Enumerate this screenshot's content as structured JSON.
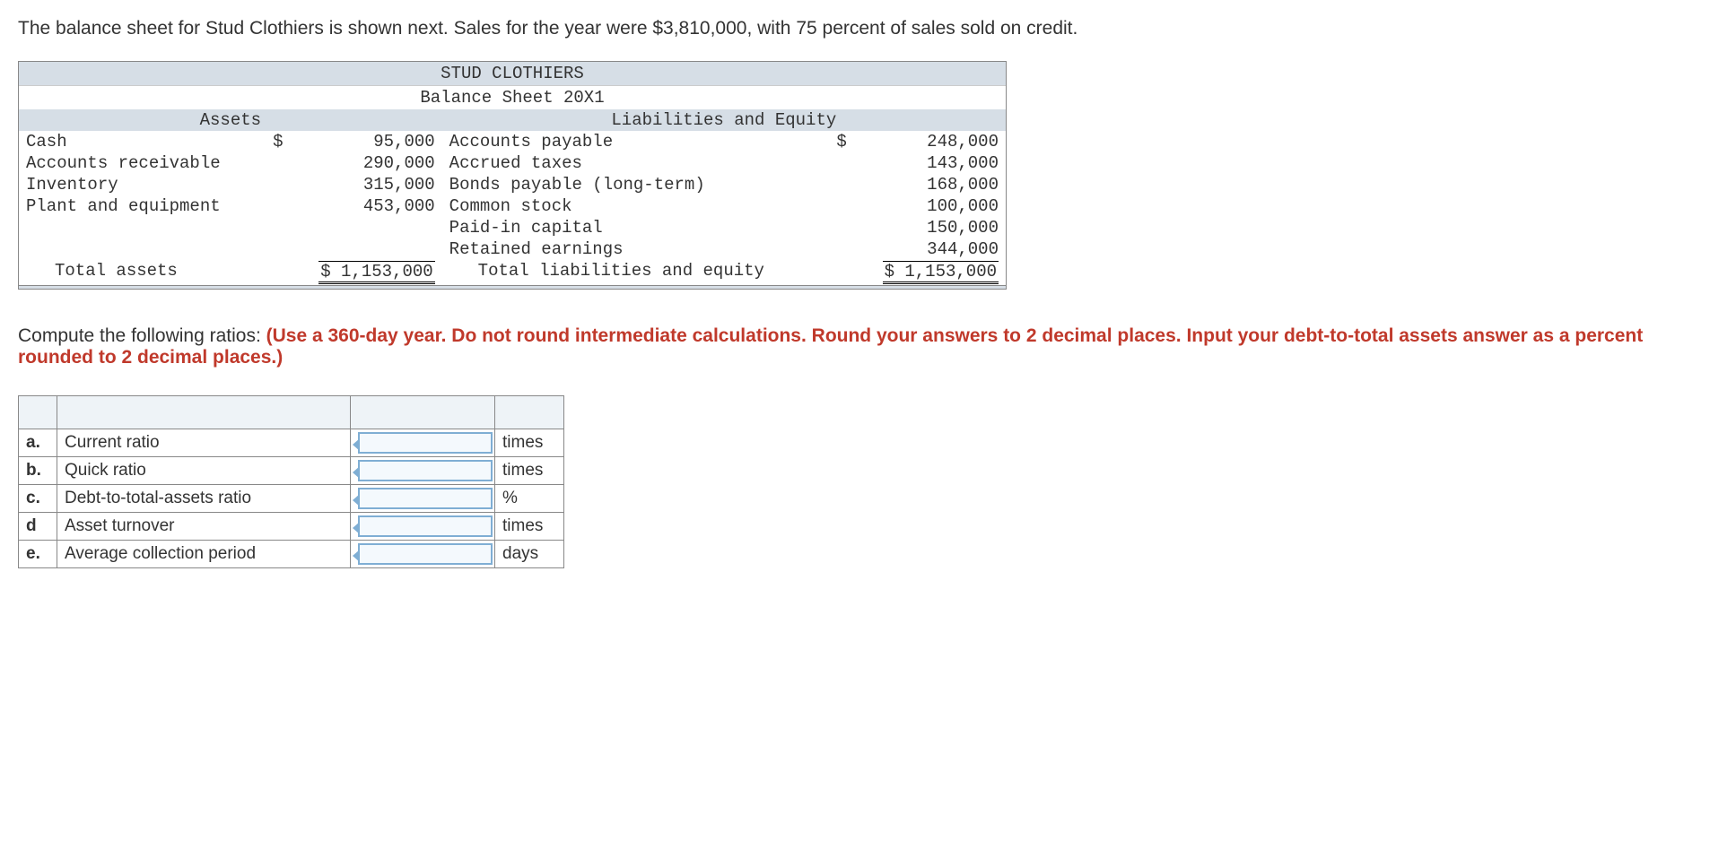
{
  "intro": "The balance sheet for Stud Clothiers is shown next. Sales for the year were $3,810,000, with 75 percent of sales sold on credit.",
  "bs": {
    "title": "STUD CLOTHIERS",
    "subtitle": "Balance Sheet 20X1",
    "assets_header": "Assets",
    "liab_header": "Liabilities and Equity",
    "assets": [
      {
        "label": "Cash",
        "cur": "$",
        "val": "95,000"
      },
      {
        "label": "Accounts receivable",
        "cur": "",
        "val": "290,000"
      },
      {
        "label": "Inventory",
        "cur": "",
        "val": "315,000"
      },
      {
        "label": "Plant and equipment",
        "cur": "",
        "val": "453,000"
      }
    ],
    "liabs": [
      {
        "label": "Accounts payable",
        "cur": "$",
        "val": "248,000"
      },
      {
        "label": "Accrued taxes",
        "cur": "",
        "val": "143,000"
      },
      {
        "label": "Bonds payable (long-term)",
        "cur": "",
        "val": "168,000"
      },
      {
        "label": "Common stock",
        "cur": "",
        "val": "100,000"
      },
      {
        "label": "Paid-in capital",
        "cur": "",
        "val": "150,000"
      },
      {
        "label": "Retained earnings",
        "cur": "",
        "val": "344,000"
      }
    ],
    "total_assets_label": "Total assets",
    "total_assets_val": "$ 1,153,000",
    "total_liab_label": "Total liabilities and equity",
    "total_liab_val": "$ 1,153,000"
  },
  "instr_lead": "Compute the following ratios: ",
  "instr_red": "(Use a 360-day year. Do not round intermediate calculations. Round your answers to 2 decimal places. Input your debt-to-total assets answer as a percent rounded to 2 decimal places.)",
  "answers": [
    {
      "letter": "a.",
      "name": "Current ratio",
      "unit": "times"
    },
    {
      "letter": "b.",
      "name": "Quick ratio",
      "unit": "times"
    },
    {
      "letter": "c.",
      "name": "Debt-to-total-assets ratio",
      "unit": "%"
    },
    {
      "letter": "d",
      "name": "Asset turnover",
      "unit": "times"
    },
    {
      "letter": "e.",
      "name": "Average collection period",
      "unit": "days"
    }
  ]
}
